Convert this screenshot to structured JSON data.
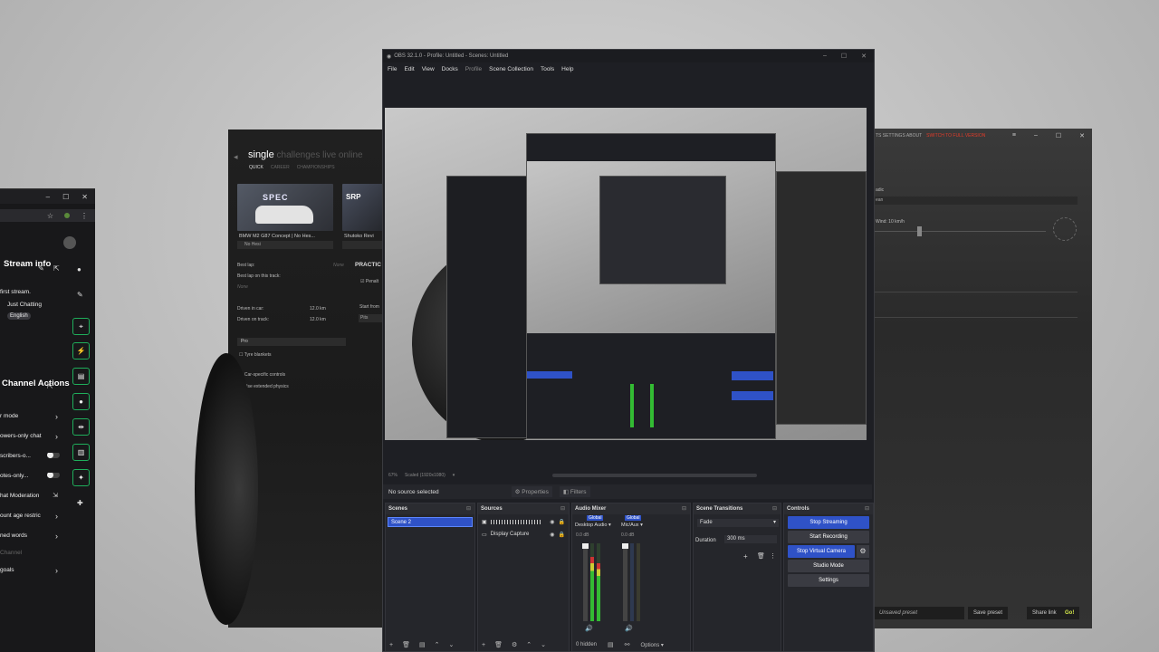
{
  "chat": {
    "stream_info_title": "Stream info",
    "stream_title": "first stream.",
    "category": "Just Chatting",
    "language": "English",
    "channel_actions_title": "Channel Actions",
    "actions": [
      {
        "label": "r mode",
        "kind": "chevron"
      },
      {
        "label": "owers-only chat",
        "kind": "chevron"
      },
      {
        "label": "scribers-o...",
        "kind": "toggle"
      },
      {
        "label": "otes-only...",
        "kind": "toggle"
      },
      {
        "label": "hat Moderation",
        "kind": "external"
      },
      {
        "label": "ount age restric",
        "kind": "chevron"
      },
      {
        "label": "ned words",
        "kind": "chevron"
      },
      {
        "label": "Channel",
        "kind": "none"
      },
      {
        "label": "goals",
        "kind": "chevron"
      }
    ]
  },
  "game": {
    "mode_active": "single",
    "modes_inactive": "challenges  live  online",
    "subtabs": [
      "QUICK",
      "CAREER",
      "CHAMPIONSHIPS"
    ],
    "car1": "BMW M2 G87 Concept | No Hes...",
    "car1_logo": "SPEC",
    "track1": "Shutoko Revi",
    "track1_logo": "SRP",
    "car_dropdown": "No Hesi",
    "best_lap_label": "Best lap:",
    "best_lap_value": "None",
    "best_lap_track_label": "Best lap on this track:",
    "best_lap_track_value": "None",
    "practice_label": "PRACTIC",
    "driven_car_label": "Driven in car:",
    "driven_car_value": "12.0 km",
    "driven_track_label": "Driven on track:",
    "driven_track_value": "12.0 km",
    "penalties_label": "Penalt",
    "start_from_label": "Start from",
    "start_from_value": "Pits",
    "preset": "Pro",
    "tyre_blankets": "Tyre blankets",
    "car_specific": "Car-specific controls",
    "extended_physics": "Use extended physics"
  },
  "right": {
    "top_links": "TS  SETTINGS  ABOUT",
    "full_version": "SWITCH TO FULL VERSION",
    "weather_label": "adic",
    "weather_value": "ean",
    "wind_label": "Wind: 10 km/h",
    "preset_field": "Unsaved preset",
    "save_preset": "Save preset",
    "share_link": "Share link",
    "go": "Go!",
    "go_color": "#d4e84b"
  },
  "obs": {
    "title": "OBS 32.1.0 - Profile: Untitled - Scenes: Untitled",
    "menu": [
      "File",
      "Edit",
      "View",
      "Docks",
      "Profile",
      "Scene Collection",
      "Tools",
      "Help"
    ],
    "zoom_status": "67%",
    "scaled_status": "Scaled (1920x1080)",
    "no_source": "No source selected",
    "properties_tab": "Properties",
    "filters_tab": "Filters",
    "scenes_title": "Scenes",
    "scene_selected": "Scene 2",
    "sources_title": "Sources",
    "sources": [
      {
        "name": "",
        "icon": "audio-bars"
      },
      {
        "name": "Display Capture",
        "icon": "monitor-icon"
      }
    ],
    "mixer_title": "Audio Mixer",
    "mixer_channels": [
      {
        "name": "Desktop Audio",
        "badge": "Global",
        "level": "0.0 dB"
      },
      {
        "name": "Mic/Aux",
        "badge": "Global",
        "level": "0.0 dB"
      }
    ],
    "meter_fill": [
      0.82,
      0.74
    ],
    "hidden_count": "0 hidden",
    "options_label": "Options",
    "transitions_title": "Scene Transitions",
    "transition": "Fade",
    "duration_label": "Duration",
    "duration_value": "300 ms",
    "controls_title": "Controls",
    "controls": [
      {
        "label": "Stop Streaming",
        "active": true
      },
      {
        "label": "Start Recording",
        "active": false
      },
      {
        "label": "Stop Virtual Camera",
        "active": true
      },
      {
        "label": "Studio Mode",
        "active": false
      },
      {
        "label": "Settings",
        "active": false
      }
    ],
    "accent": "#2f52c7"
  }
}
